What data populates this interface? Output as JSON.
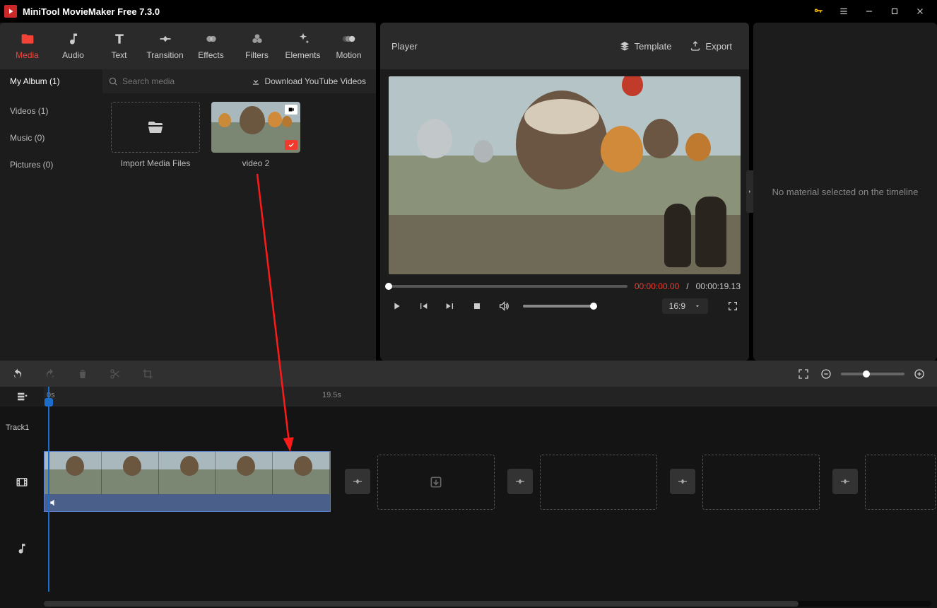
{
  "app": {
    "title": "MiniTool MovieMaker Free 7.3.0"
  },
  "nav": {
    "media": "Media",
    "audio": "Audio",
    "text": "Text",
    "transition": "Transition",
    "effects": "Effects",
    "filters": "Filters",
    "elements": "Elements",
    "motion": "Motion"
  },
  "album": {
    "tab": "My Album (1)",
    "search_placeholder": "Search media",
    "download_yt": "Download YouTube Videos"
  },
  "sidebar": {
    "videos": "Videos (1)",
    "music": "Music (0)",
    "pictures": "Pictures (0)"
  },
  "media": {
    "import_label": "Import Media Files",
    "clip1_label": "video 2"
  },
  "player": {
    "title": "Player",
    "template": "Template",
    "export": "Export",
    "current_tc": "00:00:00.00",
    "sep": " / ",
    "duration_tc": "00:00:19.13",
    "ratio": "16:9"
  },
  "props": {
    "empty": "No material selected on the timeline"
  },
  "ruler": {
    "t0": "0s",
    "t1": "19.5s"
  },
  "timeline": {
    "track1": "Track1"
  }
}
